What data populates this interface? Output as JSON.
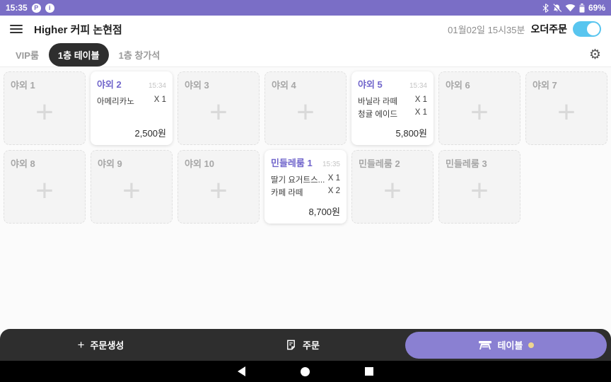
{
  "status_bar": {
    "time": "15:35",
    "battery_percent": "69%",
    "notification_icons": [
      "P",
      "i"
    ]
  },
  "header": {
    "store_name": "Higher 커피 논현점",
    "datetime": "01월02일 15시35분",
    "order_toggle_label": "오더주문",
    "order_toggle_on": true
  },
  "tab_bar": {
    "tabs": [
      {
        "label": "VIP룸",
        "active": false
      },
      {
        "label": "1층 테이블",
        "active": true
      },
      {
        "label": "1층 창가석",
        "active": false
      }
    ]
  },
  "tables": [
    {
      "name": "야외 1",
      "occupied": false
    },
    {
      "name": "야외 2",
      "occupied": true,
      "time": "15:34",
      "items": [
        {
          "name": "아메리카노",
          "qty": "X 1"
        }
      ],
      "total": "2,500원"
    },
    {
      "name": "야외 3",
      "occupied": false
    },
    {
      "name": "야외 4",
      "occupied": false
    },
    {
      "name": "야외 5",
      "occupied": true,
      "time": "15:34",
      "items": [
        {
          "name": "바닐라 라떼",
          "qty": "X 1"
        },
        {
          "name": "청귤 에이드",
          "qty": "X 1"
        }
      ],
      "total": "5,800원"
    },
    {
      "name": "야외 6",
      "occupied": false
    },
    {
      "name": "야외 7",
      "occupied": false
    },
    {
      "name": "야외 8",
      "occupied": false
    },
    {
      "name": "야외 9",
      "occupied": false
    },
    {
      "name": "야외 10",
      "occupied": false
    },
    {
      "name": "민들레룸 1",
      "occupied": true,
      "time": "15:35",
      "items": [
        {
          "name": "딸기 요거트스...",
          "qty": "X 1"
        },
        {
          "name": "카페 라떼",
          "qty": "X 2"
        }
      ],
      "total": "8,700원"
    },
    {
      "name": "민들레룸 2",
      "occupied": false
    },
    {
      "name": "민들레룸 3",
      "occupied": false
    }
  ],
  "bottom_bar": {
    "create_order_label": "주문생성",
    "order_label": "주문",
    "table_label": "테이블"
  },
  "icons": {
    "plus": "+",
    "gear": "⚙"
  },
  "colors": {
    "status_bar": "#7a6ec6",
    "accent_purple": "#7065cb",
    "pill_purple": "#8a80d2",
    "toggle_on": "#58c5ef",
    "dark_bar": "#2e2e2e",
    "indicator_dot": "#eed690"
  }
}
